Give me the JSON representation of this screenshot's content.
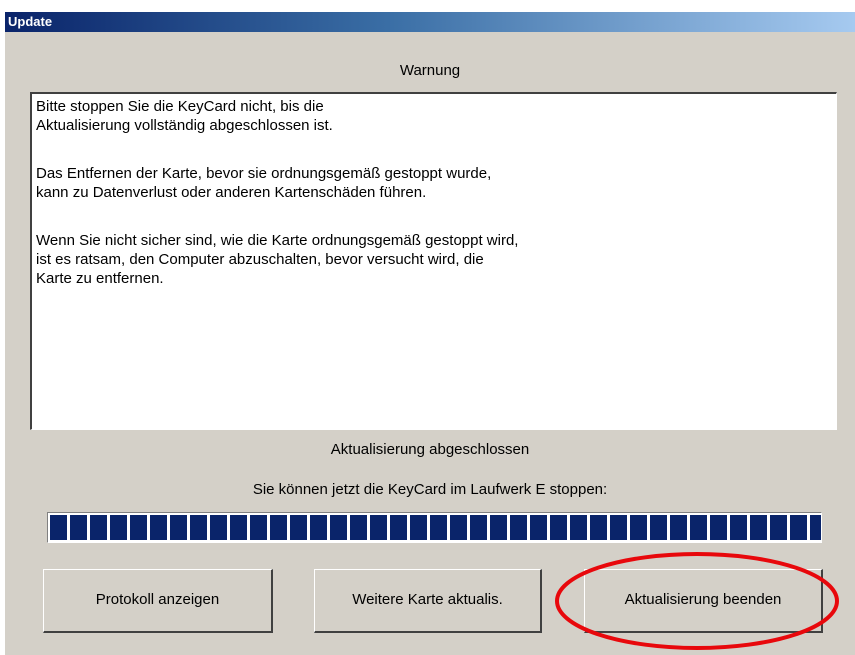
{
  "window": {
    "title": "Update"
  },
  "warning": {
    "heading": "Warnung",
    "paragraphs": [
      "Bitte stoppen Sie die KeyCard nicht, bis die\nAktualisierung vollständig abgeschlossen ist.",
      "Das Entfernen der Karte, bevor sie ordnungsgemäß gestoppt wurde,\nkann zu Datenverlust oder anderen Kartenschäden führen.",
      "Wenn Sie nicht sicher sind, wie die Karte ordnungsgemäß gestoppt wird,\nist es ratsam, den Computer abzuschalten, bevor versucht wird, die\nKarte zu entfernen."
    ]
  },
  "status": {
    "text": "Aktualisierung abgeschlossen",
    "instruction": "Sie können jetzt die KeyCard im Laufwerk E stoppen:"
  },
  "progress": {
    "percent": 100,
    "fill_color": "#0a246a"
  },
  "buttons": {
    "protocol_label": "Protokoll anzeigen",
    "next_card_label": "Weitere Karte aktualis.",
    "finish_label": "Aktualisierung beenden"
  },
  "annotation": {
    "highlight_color": "#e8080c",
    "highlighted_target": "finish-button"
  }
}
